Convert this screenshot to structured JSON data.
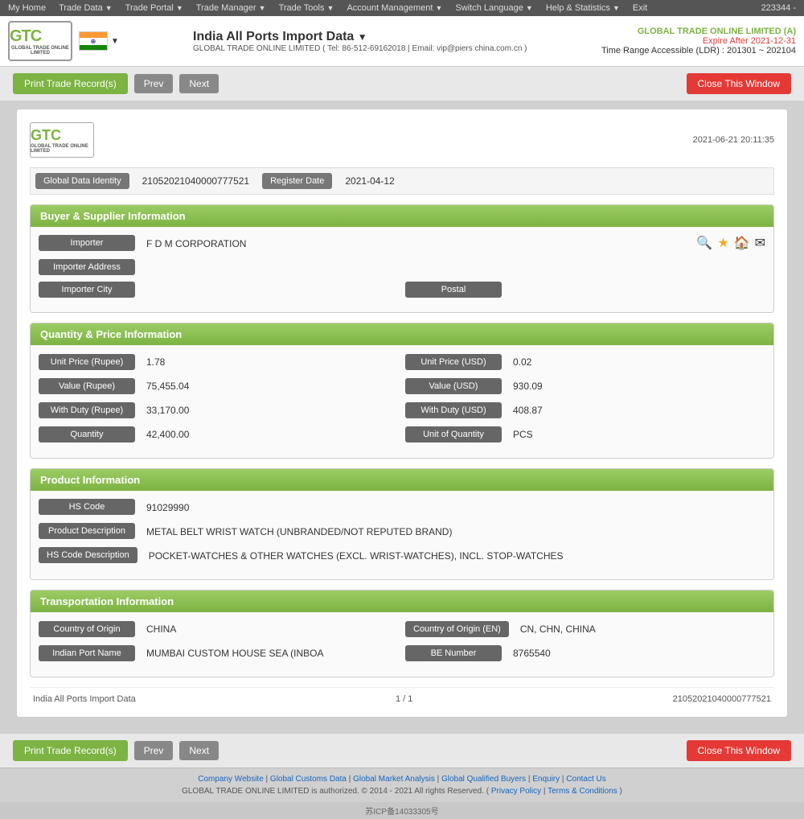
{
  "topnav": {
    "items": [
      {
        "label": "My Home",
        "id": "my-home"
      },
      {
        "label": "Trade Data",
        "id": "trade-data"
      },
      {
        "label": "Trade Portal",
        "id": "trade-portal"
      },
      {
        "label": "Trade Manager",
        "id": "trade-manager"
      },
      {
        "label": "Trade Tools",
        "id": "trade-tools"
      },
      {
        "label": "Account Management",
        "id": "account-management"
      },
      {
        "label": "Switch Language",
        "id": "switch-language"
      },
      {
        "label": "Help & Statistics",
        "id": "help-statistics"
      },
      {
        "label": "Exit",
        "id": "exit"
      }
    ],
    "user_id": "223344 -"
  },
  "header": {
    "logo_text": "GTC",
    "logo_subtext": "GLOBAL TRADE ONLINE LIMITED",
    "title": "India All Ports Import Data",
    "subtitle": "GLOBAL TRADE ONLINE LIMITED ( Tel: 86-512-69162018 | Email: vip@piers china.com.cn )",
    "company": "GLOBAL TRADE ONLINE LIMITED (A)",
    "expire": "Expire After 2021-12-31",
    "time_range": "Time Range Accessible (LDR) : 201301 ~ 202104"
  },
  "toolbar": {
    "print_label": "Print Trade Record(s)",
    "prev_label": "Prev",
    "next_label": "Next",
    "close_label": "Close This Window"
  },
  "record": {
    "logo_text": "GTC",
    "date_time": "2021-06-21 20:11:35",
    "global_data_identity_label": "Global Data Identity",
    "global_data_identity_value": "21052021040000777521",
    "register_date_label": "Register Date",
    "register_date_value": "2021-04-12",
    "sections": {
      "buyer_supplier": {
        "title": "Buyer & Supplier Information",
        "fields": [
          {
            "label": "Importer",
            "value": "F D M CORPORATION",
            "id": "importer",
            "full_width": true,
            "has_icons": true
          },
          {
            "label": "Importer Address",
            "value": "",
            "id": "importer-address",
            "full_width": true
          },
          {
            "label": "Importer City",
            "value": "",
            "id": "importer-city",
            "half": true,
            "pair_label": "Postal",
            "pair_value": ""
          }
        ],
        "icons": [
          "🔍",
          "★",
          "🏠",
          "✉"
        ]
      },
      "quantity_price": {
        "title": "Quantity & Price Information",
        "rows": [
          {
            "left_label": "Unit Price (Rupee)",
            "left_value": "1.78",
            "right_label": "Unit Price (USD)",
            "right_value": "0.02"
          },
          {
            "left_label": "Value (Rupee)",
            "left_value": "75,455.04",
            "right_label": "Value (USD)",
            "right_value": "930.09"
          },
          {
            "left_label": "With Duty (Rupee)",
            "left_value": "33,170.00",
            "right_label": "With Duty (USD)",
            "right_value": "408.87"
          },
          {
            "left_label": "Quantity",
            "left_value": "42,400.00",
            "right_label": "Unit of Quantity",
            "right_value": "PCS"
          }
        ]
      },
      "product": {
        "title": "Product Information",
        "rows": [
          {
            "label": "HS Code",
            "value": "91029990"
          },
          {
            "label": "Product Description",
            "value": "METAL BELT WRIST WATCH (UNBRANDED/NOT REPUTED BRAND)"
          },
          {
            "label": "HS Code Description",
            "value": "POCKET-WATCHES & OTHER WATCHES (EXCL. WRIST-WATCHES), INCL. STOP-WATCHES"
          }
        ]
      },
      "transportation": {
        "title": "Transportation Information",
        "rows": [
          {
            "left_label": "Country of Origin",
            "left_value": "CHINA",
            "right_label": "Country of Origin (EN)",
            "right_value": "CN, CHN, CHINA"
          },
          {
            "left_label": "Indian Port Name",
            "left_value": "MUMBAI CUSTOM HOUSE SEA (INBOA",
            "right_label": "BE Number",
            "right_value": "8765540"
          }
        ]
      }
    },
    "footer": {
      "left": "India All Ports Import Data",
      "center": "1 / 1",
      "right": "21052021040000777521"
    }
  },
  "footer": {
    "links": [
      "Company Website",
      "Global Customs Data",
      "Global Market Analysis",
      "Global Qualified Buyers",
      "Enquiry",
      "Contact Us"
    ],
    "copyright": "GLOBAL TRADE ONLINE LIMITED is authorized. © 2014 - 2021 All rights Reserved.",
    "privacy": "Privacy Policy",
    "terms": "Terms & Conditions",
    "icp": "苏ICP备14033305号"
  },
  "colors": {
    "green": "#7cb342",
    "red": "#e53935",
    "dark_gray": "#666",
    "nav_bg": "#555"
  }
}
